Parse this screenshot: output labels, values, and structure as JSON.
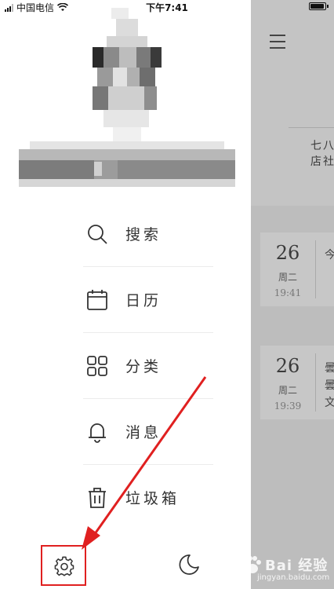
{
  "status_bar": {
    "carrier": "中国电信",
    "time": "下午7:41"
  },
  "background_page": {
    "header_snippet_line1": "七八",
    "header_snippet_line2": "店社",
    "entries": [
      {
        "day": "26",
        "weekday": "周二",
        "time": "19:41",
        "snippet": "今"
      },
      {
        "day": "26",
        "weekday": "周二",
        "time": "19:39",
        "snippet": "曇曇文"
      }
    ]
  },
  "drawer": {
    "menu": [
      {
        "label": "搜索",
        "icon": "search-icon"
      },
      {
        "label": "日历",
        "icon": "calendar-icon"
      },
      {
        "label": "分类",
        "icon": "grid-icon"
      },
      {
        "label": "消息",
        "icon": "bell-icon"
      },
      {
        "label": "垃圾箱",
        "icon": "trash-icon"
      }
    ],
    "settings_icon": "gear-icon",
    "night_mode_icon": "moon-icon",
    "highlight_color": "#e02020"
  },
  "watermark": {
    "brand": "Bai 经验",
    "url": "jingyan.baidu.com"
  }
}
